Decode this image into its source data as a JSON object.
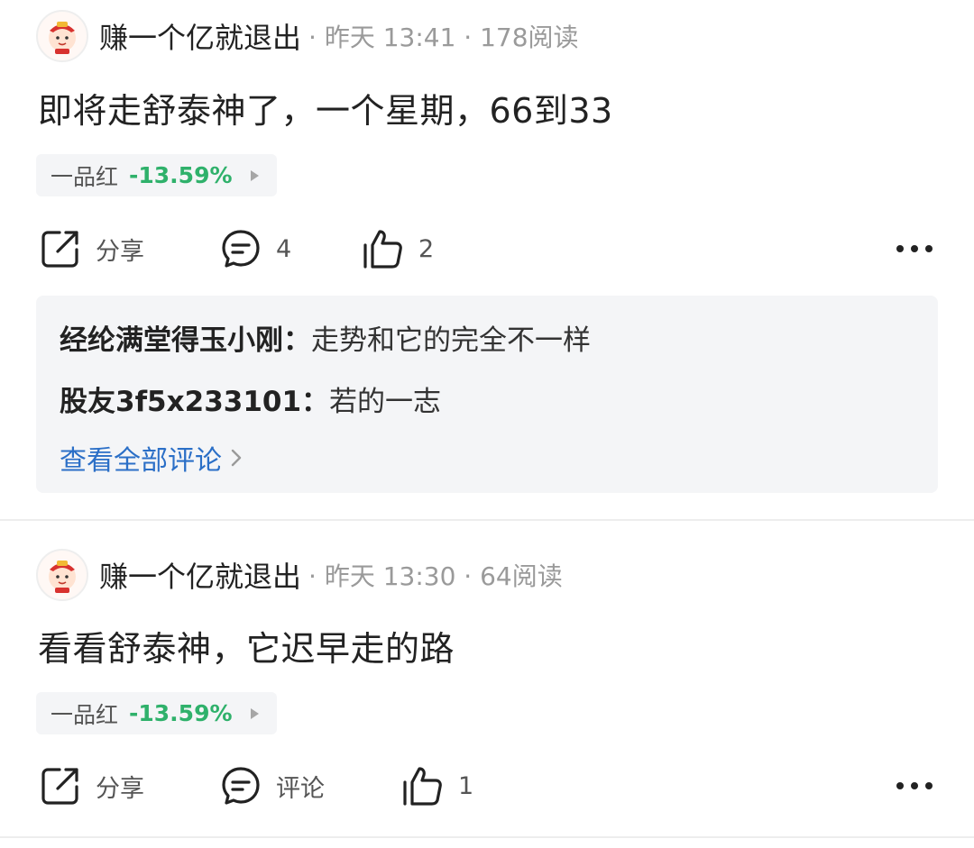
{
  "posts": [
    {
      "author": "赚一个亿就退出",
      "meta": "· 昨天 13:41 · 178阅读",
      "content": "即将走舒泰神了，一个星期，66到33",
      "stock": {
        "name": "一品红",
        "change": "-13.59%"
      },
      "actions": {
        "share_label": "分享",
        "comment_label": "4",
        "like_label": "2"
      },
      "comments": [
        {
          "author": "经纶满堂得玉小刚：",
          "text": "走势和它的完全不一样"
        },
        {
          "author": "股友3f5x233101：",
          "text": "若的一志"
        }
      ],
      "view_all_label": "查看全部评论"
    },
    {
      "author": "赚一个亿就退出",
      "meta": "· 昨天 13:30 · 64阅读",
      "content": "看看舒泰神，它迟早走的路",
      "stock": {
        "name": "一品红",
        "change": "-13.59%"
      },
      "actions": {
        "share_label": "分享",
        "comment_label": "评论",
        "like_label": "1"
      }
    }
  ],
  "colors": {
    "accent_link": "#2b6fc7",
    "stock_change": "#2fb16b",
    "panel_bg": "#f4f5f7"
  },
  "icons": [
    "share-icon",
    "comment-icon",
    "thumbs-up-icon",
    "more-icon",
    "chevron-right-icon",
    "avatar"
  ]
}
